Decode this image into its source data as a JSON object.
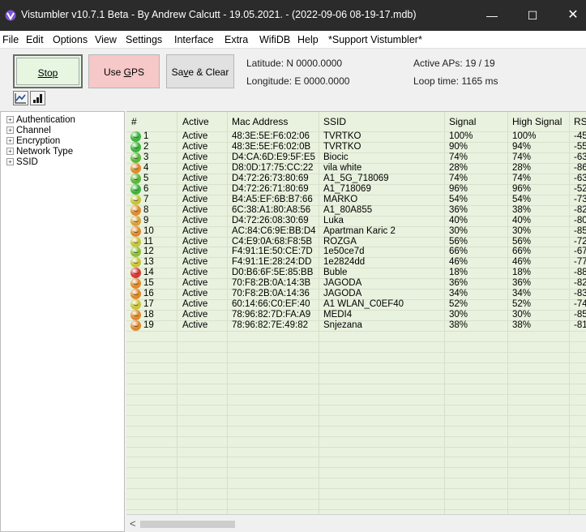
{
  "window": {
    "title": "Vistumbler v10.7.1 Beta - By Andrew Calcutt - 19.05.2021. - (2022-09-06 08-19-17.mdb)",
    "app_icon": "vistumbler-logo-icon",
    "controls": {
      "minimize": "—",
      "maximize": "☐",
      "close": "✕"
    }
  },
  "menu": [
    "File",
    "Edit",
    "Options",
    "View",
    "Settings",
    "Interface",
    "Extra",
    "WifiDB",
    "Help",
    "*Support Vistumbler*"
  ],
  "toolbar": {
    "stop_label": "Stop",
    "gps_label_prefix": "Use ",
    "gps_label_u": "G",
    "gps_label_suffix": "PS",
    "save_label_prefix": "Sa",
    "save_label_u": "v",
    "save_label_suffix": "e & Clear",
    "latitude": "Latitude: N 0000.0000",
    "longitude": "Longitude: E 0000.0000",
    "active_aps": "Active APs: 19 / 19",
    "loop_time": "Loop time: 1165 ms",
    "graph_buttons": [
      "line-graph-icon",
      "bar-graph-icon"
    ]
  },
  "tree": [
    "Authentication",
    "Channel",
    "Encryption",
    "Network Type",
    "SSID"
  ],
  "table": {
    "headers": [
      "#",
      "Active",
      "Mac Address",
      "SSID",
      "Signal",
      "High Signal",
      "RS"
    ],
    "rows": [
      {
        "num": "1",
        "active": "Active",
        "mac": "48:3E:5E:F6:02:06",
        "ssid": "TVRTKO",
        "signal": "100%",
        "high": "100%",
        "rssi": "-45",
        "dot": "#3cb53c"
      },
      {
        "num": "2",
        "active": "Active",
        "mac": "48:3E:5E:F6:02:0B",
        "ssid": "TVRTKO",
        "signal": "90%",
        "high": "94%",
        "rssi": "-55",
        "dot": "#3cb53c"
      },
      {
        "num": "3",
        "active": "Active",
        "mac": "D4:CA:6D:E9:5F:E5",
        "ssid": "Biocic",
        "signal": "74%",
        "high": "74%",
        "rssi": "-63",
        "dot": "#5db83a"
      },
      {
        "num": "4",
        "active": "Active",
        "mac": "D8:0D:17:75:CC:22",
        "ssid": "vila white",
        "signal": "28%",
        "high": "28%",
        "rssi": "-86",
        "dot": "#e08a2c"
      },
      {
        "num": "5",
        "active": "Active",
        "mac": "D4:72:26:73:80:69",
        "ssid": "A1_5G_718069",
        "signal": "74%",
        "high": "74%",
        "rssi": "-63",
        "dot": "#5db83a"
      },
      {
        "num": "6",
        "active": "Active",
        "mac": "D4:72:26:71:80:69",
        "ssid": "A1_718069",
        "signal": "96%",
        "high": "96%",
        "rssi": "-52",
        "dot": "#3cb53c"
      },
      {
        "num": "7",
        "active": "Active",
        "mac": "B4:A5:EF:6B:B7:66",
        "ssid": "MARKO",
        "signal": "54%",
        "high": "54%",
        "rssi": "-73",
        "dot": "#c9c43a"
      },
      {
        "num": "8",
        "active": "Active",
        "mac": "6C:38:A1:80:A8:56",
        "ssid": "A1_80A855",
        "signal": "36%",
        "high": "38%",
        "rssi": "-82",
        "dot": "#e08a2c"
      },
      {
        "num": "9",
        "active": "Active",
        "mac": "D4:72:26:08:30:69",
        "ssid": "Luka",
        "signal": "40%",
        "high": "40%",
        "rssi": "-80",
        "dot": "#d9a23a"
      },
      {
        "num": "10",
        "active": "Active",
        "mac": "AC:84:C6:9E:BB:D4",
        "ssid": "Apartman Karic 2",
        "signal": "30%",
        "high": "30%",
        "rssi": "-85",
        "dot": "#e08a2c"
      },
      {
        "num": "11",
        "active": "Active",
        "mac": "C4:E9:0A:68:F8:5B",
        "ssid": "ROZGA",
        "signal": "56%",
        "high": "56%",
        "rssi": "-72",
        "dot": "#c9c43a"
      },
      {
        "num": "12",
        "active": "Active",
        "mac": "F4:91:1E:50:CE:7D",
        "ssid": "1e50ce7d",
        "signal": "66%",
        "high": "66%",
        "rssi": "-67",
        "dot": "#8fbf3a"
      },
      {
        "num": "13",
        "active": "Active",
        "mac": "F4:91:1E:28:24:DD",
        "ssid": "1e2824dd",
        "signal": "46%",
        "high": "46%",
        "rssi": "-77",
        "dot": "#c9c43a"
      },
      {
        "num": "14",
        "active": "Active",
        "mac": "D0:B6:6F:5E:85:BB",
        "ssid": "Buble",
        "signal": "18%",
        "high": "18%",
        "rssi": "-88",
        "dot": "#d83a3a"
      },
      {
        "num": "15",
        "active": "Active",
        "mac": "70:F8:2B:0A:14:3B",
        "ssid": "JAGODA",
        "signal": "36%",
        "high": "36%",
        "rssi": "-82",
        "dot": "#e08a2c"
      },
      {
        "num": "16",
        "active": "Active",
        "mac": "70:F8:2B:0A:14:36",
        "ssid": "JAGODA",
        "signal": "34%",
        "high": "34%",
        "rssi": "-83",
        "dot": "#e08a2c"
      },
      {
        "num": "17",
        "active": "Active",
        "mac": "60:14:66:C0:EF:40",
        "ssid": "A1 WLAN_C0EF40",
        "signal": "52%",
        "high": "52%",
        "rssi": "-74",
        "dot": "#c9c43a"
      },
      {
        "num": "18",
        "active": "Active",
        "mac": "78:96:82:7D:FA:A9",
        "ssid": "MEDI4",
        "signal": "30%",
        "high": "30%",
        "rssi": "-85",
        "dot": "#e08a2c"
      },
      {
        "num": "19",
        "active": "Active",
        "mac": "78:96:82:7E:49:82",
        "ssid": "Snjezana",
        "signal": "38%",
        "high": "38%",
        "rssi": "-81",
        "dot": "#e08a2c"
      }
    ]
  },
  "scrollbar": {
    "left_arrow": "<"
  },
  "colors": {
    "titlebar": "#2b2b2b",
    "table_bg": "#e9f2de",
    "stop_bg": "#e6f6e1",
    "gps_bg": "#f6c8c8"
  }
}
